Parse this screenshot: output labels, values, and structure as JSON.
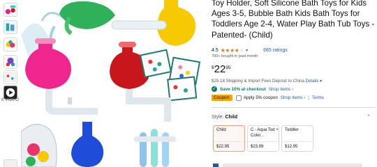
{
  "thumbnails": [
    {
      "icon": "product-thumb-icon"
    },
    {
      "icon": "product-thumb-icon"
    },
    {
      "icon": "product-thumb-icon"
    },
    {
      "icon": "product-thumb-icon"
    },
    {
      "icon": "product-thumb-icon"
    },
    {
      "icon": "product-thumb-icon"
    },
    {
      "icon": "play-icon"
    }
  ],
  "video_label": "6 VIDEO",
  "product": {
    "title": "Toy Holder, Soft Silicone Bath Toys for Kids Ages 3-5, Bubble Bath Kids Bath Toys for Toddlers Age 2-4, Water Play Bath Tub Toys - Patented- (Child)",
    "rating": "4.5",
    "rating_fraction": 0.9,
    "ratings_count": "665 ratings",
    "bought": "700+ bought in past month",
    "price": {
      "symbol": "$",
      "whole": "22",
      "fraction": "95"
    },
    "shipping_text": "$25.18 Shipping & Import Fees Deposit to China",
    "shipping_link": "Details",
    "save_text": "Save 10% at checkout",
    "save_link": "Shop items",
    "coupon_badge": "Coupon:",
    "coupon_text": "Apply 5% coupon",
    "coupon_link": "Shop items",
    "terms_link": "Terms",
    "style_label": "Style:",
    "style_value": "Child",
    "styles": [
      {
        "name": "Child",
        "price": "$22.95",
        "selected": true
      },
      {
        "name": "C - Aqua Tod + Color...",
        "price": "$23.99",
        "selected": false
      },
      {
        "name": "Toddler",
        "price": "$12.95",
        "selected": false
      }
    ]
  },
  "colors": {
    "star": "#de7921",
    "link": "#2162a1",
    "save_green": "#067d62",
    "coupon_badge": "#f7a400",
    "selected_swatch_border": "#e3a07c"
  }
}
